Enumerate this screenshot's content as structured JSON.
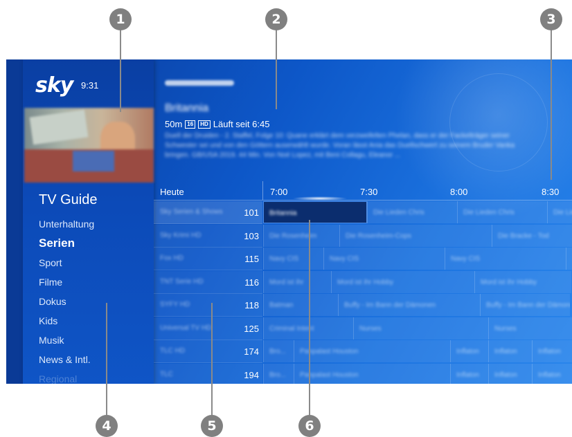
{
  "callouts": [
    "1",
    "2",
    "3",
    "4",
    "5",
    "6"
  ],
  "sidebar": {
    "logo": "sky",
    "time": "9:31",
    "title": "TV Guide",
    "items": [
      {
        "label": "Unterhaltung",
        "state": "normal"
      },
      {
        "label": "Serien",
        "state": "active"
      },
      {
        "label": "Sport",
        "state": "normal"
      },
      {
        "label": "Filme",
        "state": "normal"
      },
      {
        "label": "Dokus",
        "state": "normal"
      },
      {
        "label": "Kids",
        "state": "normal"
      },
      {
        "label": "Musik",
        "state": "normal"
      },
      {
        "label": "News & Intl.",
        "state": "normal"
      },
      {
        "label": "Regional",
        "state": "faded"
      }
    ]
  },
  "info": {
    "channel_tag": "Sky Serien & Shows",
    "title": "Britannia",
    "duration": "50m",
    "age_rating": "16",
    "hd_badge": "HD",
    "status": "Läuft seit 6:45",
    "description": "Duell der Druiden - 2. Staffel, Folge 10: Quane erklärt dem verzweifelten Phelan, dass er der Fackelträger seiner Schwester sei und von den Göttern auserwählt wurde. Voran lässt Ania das Duellschwert zu seinem Bruder Vanka bringen. GB/USA 2019. 44 Min. Von Noé Lopez, mit Beni Collagu, Eleanor ..."
  },
  "guide": {
    "day": "Heute",
    "times": [
      "7:00",
      "7:30",
      "8:00",
      "8:30"
    ],
    "rows": [
      {
        "channel": "Sky Serien & Shows",
        "number": "101",
        "programs": [
          {
            "title": "Britannia",
            "focus": true
          },
          {
            "title": "Die Lieden Chris"
          },
          {
            "title": "Die Lieden Chris"
          },
          {
            "title": "Die Lieden Chris"
          }
        ]
      },
      {
        "channel": "Sky Krimi HD",
        "number": "103",
        "programs": [
          {
            "title": "Die Rosenheim"
          },
          {
            "title": "Die Rosenheim-Cops"
          },
          {
            "title": "Die Bracke - Tod"
          }
        ]
      },
      {
        "channel": "Fox HD",
        "number": "115",
        "programs": [
          {
            "title": "Navy CIS"
          },
          {
            "title": "Navy CIS"
          },
          {
            "title": "Navy CIS"
          },
          {
            "title": ""
          }
        ]
      },
      {
        "channel": "TNT Serie HD",
        "number": "116",
        "programs": [
          {
            "title": "Mord ist ihr"
          },
          {
            "title": "Mord ist ihr Hobby"
          },
          {
            "title": "Mord ist ihr Hobby"
          }
        ]
      },
      {
        "channel": "SYFY HD",
        "number": "118",
        "programs": [
          {
            "title": "Batman"
          },
          {
            "title": "Buffy - Im Bann der Dämonen"
          },
          {
            "title": "Buffy - Im Bann der Dämonen"
          }
        ]
      },
      {
        "channel": "Universal TV HD",
        "number": "125",
        "programs": [
          {
            "title": "Criminal Intent"
          },
          {
            "title": "Nurses"
          },
          {
            "title": "Nurses"
          }
        ]
      },
      {
        "channel": "TLC HD",
        "number": "174",
        "programs": [
          {
            "title": "Bro..."
          },
          {
            "title": "Panpalast Houston"
          },
          {
            "title": "Inflaton"
          },
          {
            "title": "Inflaton"
          },
          {
            "title": "Inflaton"
          }
        ]
      },
      {
        "channel": "TLC",
        "number": "194",
        "programs": [
          {
            "title": "Bro..."
          },
          {
            "title": "Panpalast Houston"
          },
          {
            "title": "Inflaton"
          },
          {
            "title": "Inflaton"
          },
          {
            "title": "Inflaton"
          }
        ]
      }
    ]
  },
  "colors": {
    "screen_blue": "#0d57c8",
    "sidebar_blue": "#0a3fa3",
    "focus_cell": "#0b2d6e",
    "callout_grey": "#808080"
  }
}
